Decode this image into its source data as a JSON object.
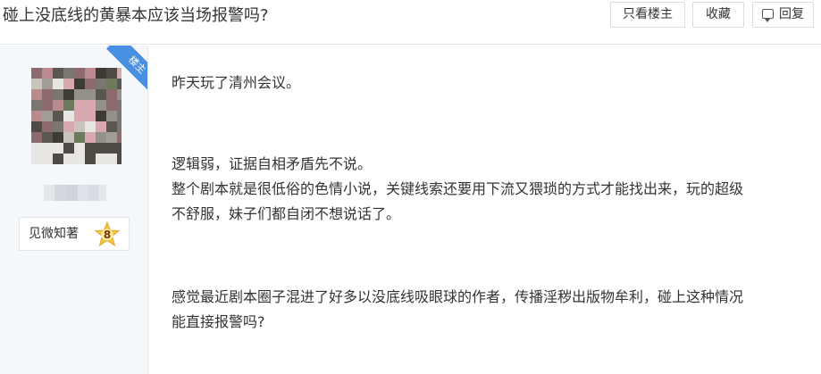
{
  "header": {
    "title": "碰上没底线的黄暴本应该当场报警吗?",
    "buttons": {
      "only_op": "只看楼主",
      "favorite": "收藏",
      "reply": "回复"
    }
  },
  "author": {
    "badge": "楼主",
    "rank_label": "见微知著",
    "rank_level": "8"
  },
  "post": {
    "lines": [
      "昨天玩了清州会议。",
      "逻辑弱，证据自相矛盾先不说。",
      "整个剧本就是很低俗的色情小说，关键线索还要用下流又猥琐的方式才能找出来，玩的超级",
      "不舒服，妹子们都自闭不想说话了。",
      "感觉最近剧本圈子混进了好多以没底线吸眼球的作者，传播淫秽出版物牟利，碰上这种情况",
      "能直接报警吗?"
    ]
  },
  "colors": {
    "accent": "#4a90e2",
    "sidebar_bg": "#f5f8fa",
    "badge_gold": "#f5c542"
  }
}
